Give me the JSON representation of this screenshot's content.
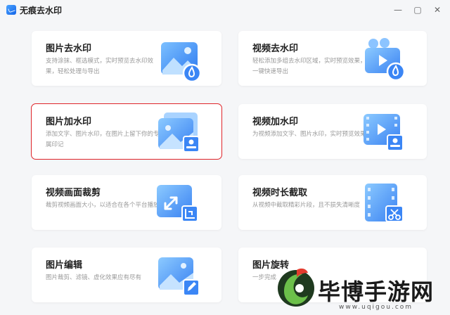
{
  "app": {
    "title": "无痕去水印"
  },
  "window_controls": {
    "minimize": "—",
    "maximize": "▢",
    "close": "✕"
  },
  "cards": [
    {
      "title": "图片去水印",
      "desc": "支持涂抹、框选模式，实时预览去水印效果，轻松处理与导出",
      "icon": "image-remove-watermark-icon"
    },
    {
      "title": "视频去水印",
      "desc": "轻松添加多组去水印区域，实时预览效果，一键快速导出",
      "icon": "video-remove-watermark-icon"
    },
    {
      "title": "图片加水印",
      "desc": "添加文字、图片水印，在图片上留下你的专属印记",
      "icon": "image-add-watermark-icon",
      "selected": true
    },
    {
      "title": "视频加水印",
      "desc": "为视频添加文字、图片水印，实时预览效果",
      "icon": "video-add-watermark-icon"
    },
    {
      "title": "视频画面裁剪",
      "desc": "裁剪视频画面大小，以适合在各个平台播放",
      "icon": "video-crop-icon"
    },
    {
      "title": "视频时长截取",
      "desc": "从视频中截取精彩片段，且不损失清晰度",
      "icon": "video-trim-icon"
    },
    {
      "title": "图片编辑",
      "desc": "图片裁剪、滤镜、虚化效果应有尽有",
      "icon": "image-edit-icon"
    },
    {
      "title": "图片旋转",
      "desc": "一步完成",
      "icon": "image-rotate-icon"
    }
  ],
  "watermark_overlay": {
    "text": "毕博手游网",
    "url": "www.uqigou.com",
    "icon": "site-logo-icon"
  }
}
